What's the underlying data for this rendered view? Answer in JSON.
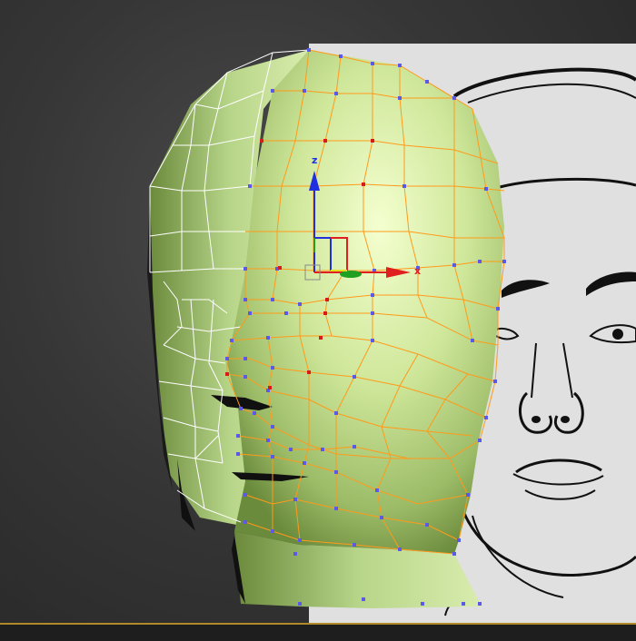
{
  "viewport": {
    "label": "",
    "background": "#2a2a2a",
    "accent_border": "#b08a2a"
  },
  "reference_image": {
    "subject": "front-face-sketch",
    "background": "#e0e0e0",
    "line_color": "#111111"
  },
  "model": {
    "mesh_color": "#cfe79a",
    "selected_edge_color": "#ff9a1a",
    "unselected_edge_color": "#ffffff",
    "vertex_color": "#5a5ae6",
    "selected_vertex_color": "#d81a1a"
  },
  "gizmo": {
    "x_label": "x",
    "z_label": "z",
    "x_color": "#e02020",
    "y_color": "#20b020",
    "z_color": "#2030e0"
  }
}
